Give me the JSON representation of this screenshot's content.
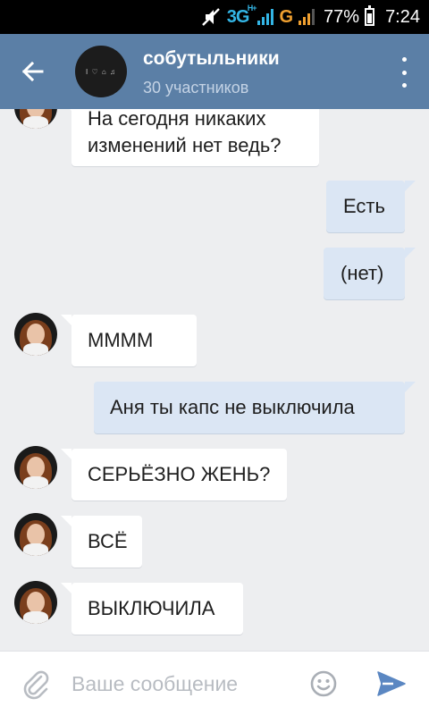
{
  "status_bar": {
    "network_type": "3G",
    "network_sup": "H+",
    "network_g": "G",
    "battery_percent": "77%",
    "time": "7:24",
    "accent_color": "#33b5e5",
    "g_color": "#f0a030"
  },
  "header": {
    "chat_title": "собутыльники",
    "subtitle": "30 участников",
    "avatar_text": "I ♡ ⌂ ♫",
    "background_color": "#5b7fa6"
  },
  "messages": [
    {
      "direction": "in",
      "text_lines": [
        "На сегодня никаких",
        "изменений нет ведь?"
      ]
    },
    {
      "direction": "out",
      "text_lines": [
        "Есть"
      ]
    },
    {
      "direction": "out",
      "text_lines": [
        "(нет)"
      ]
    },
    {
      "direction": "in",
      "text_lines": [
        "ММММ"
      ]
    },
    {
      "direction": "out",
      "text_lines": [
        "Аня ты капс не выключила"
      ]
    },
    {
      "direction": "in",
      "text_lines": [
        "СЕРЬЁЗНО ЖЕНЬ?"
      ]
    },
    {
      "direction": "in",
      "text_lines": [
        "ВСЁ"
      ]
    },
    {
      "direction": "in",
      "text_lines": [
        "ВЫКЛЮЧИЛА"
      ]
    }
  ],
  "input": {
    "placeholder": "Ваше сообщение",
    "value": ""
  },
  "icons": {
    "back": "arrow-left-icon",
    "menu": "more-vertical-icon",
    "attach": "paperclip-icon",
    "emoji": "smiley-icon",
    "send": "send-icon"
  }
}
